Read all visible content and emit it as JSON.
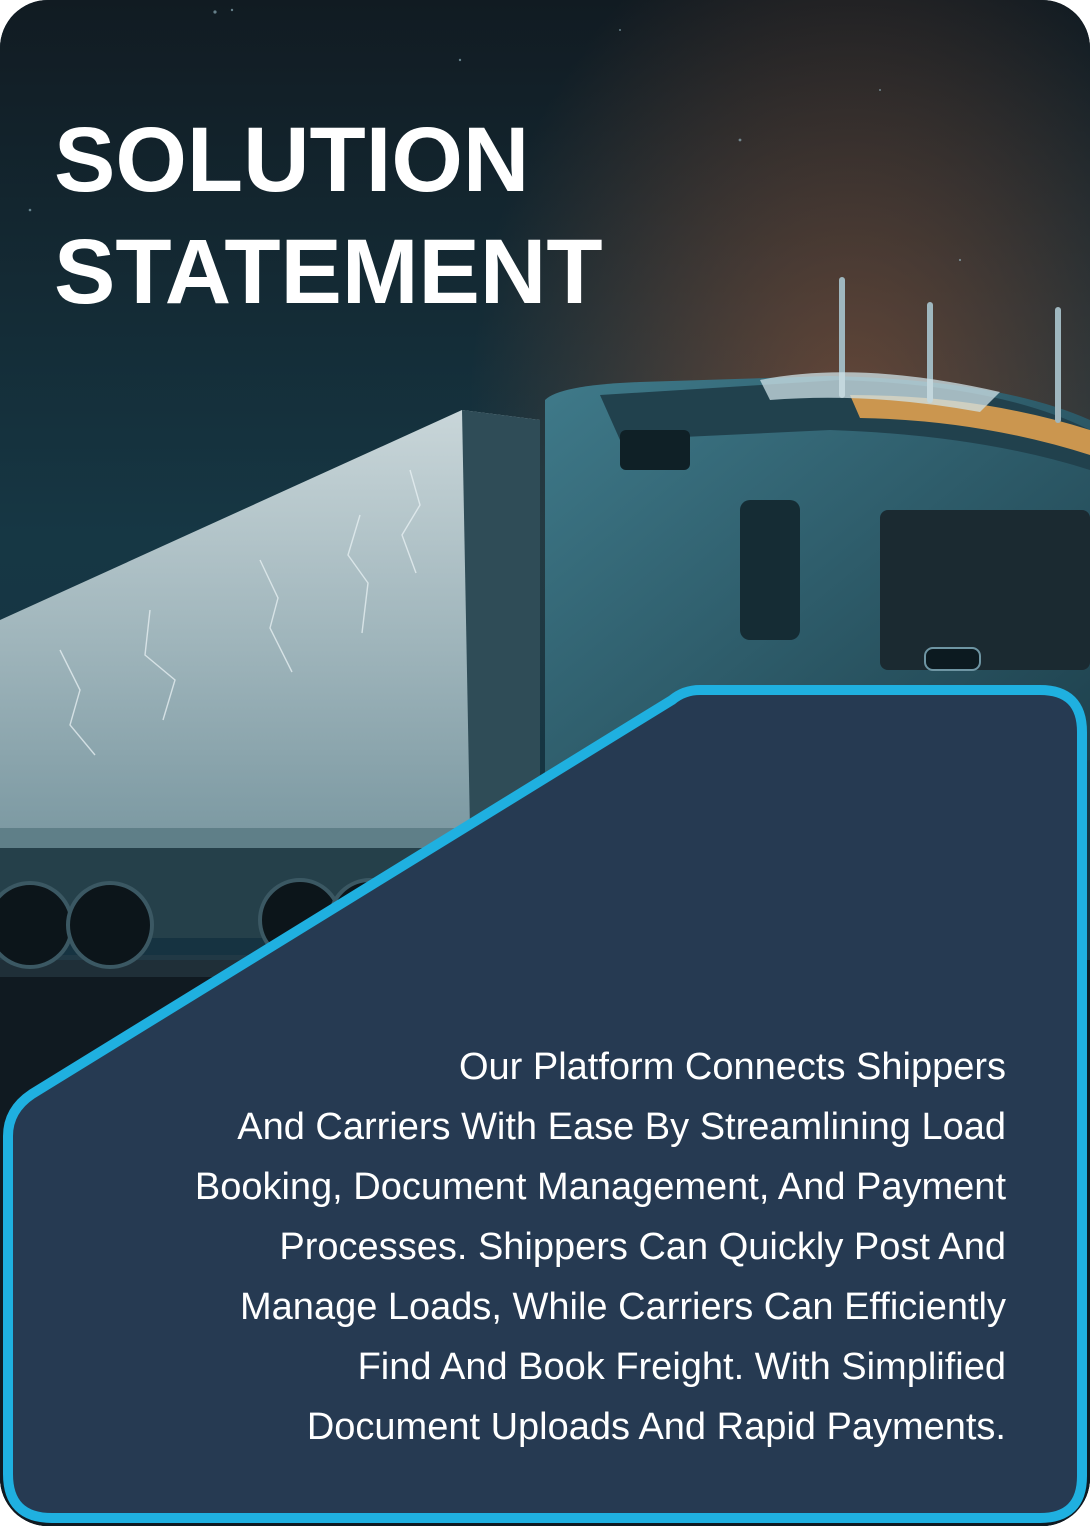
{
  "card": {
    "title_lines": [
      "SOLUTION",
      "STATEMENT"
    ],
    "body_lines": [
      "Our Platform Connects Shippers",
      "And Carriers With Ease By Streamlining Load",
      "Booking, Document Management, And Payment",
      "Processes. Shippers Can Quickly Post And",
      "Manage Loads, While Carriers Can Efficiently",
      "Find And Book Freight. With Simplified",
      "Document Uploads And Rapid Payments."
    ]
  },
  "image": {
    "subject": "semi-truck-at-night"
  },
  "colors": {
    "panel_fill": "#263a52",
    "panel_border": "#1fb0e0",
    "title_text": "#ffffff",
    "body_text": "#ffffff"
  }
}
